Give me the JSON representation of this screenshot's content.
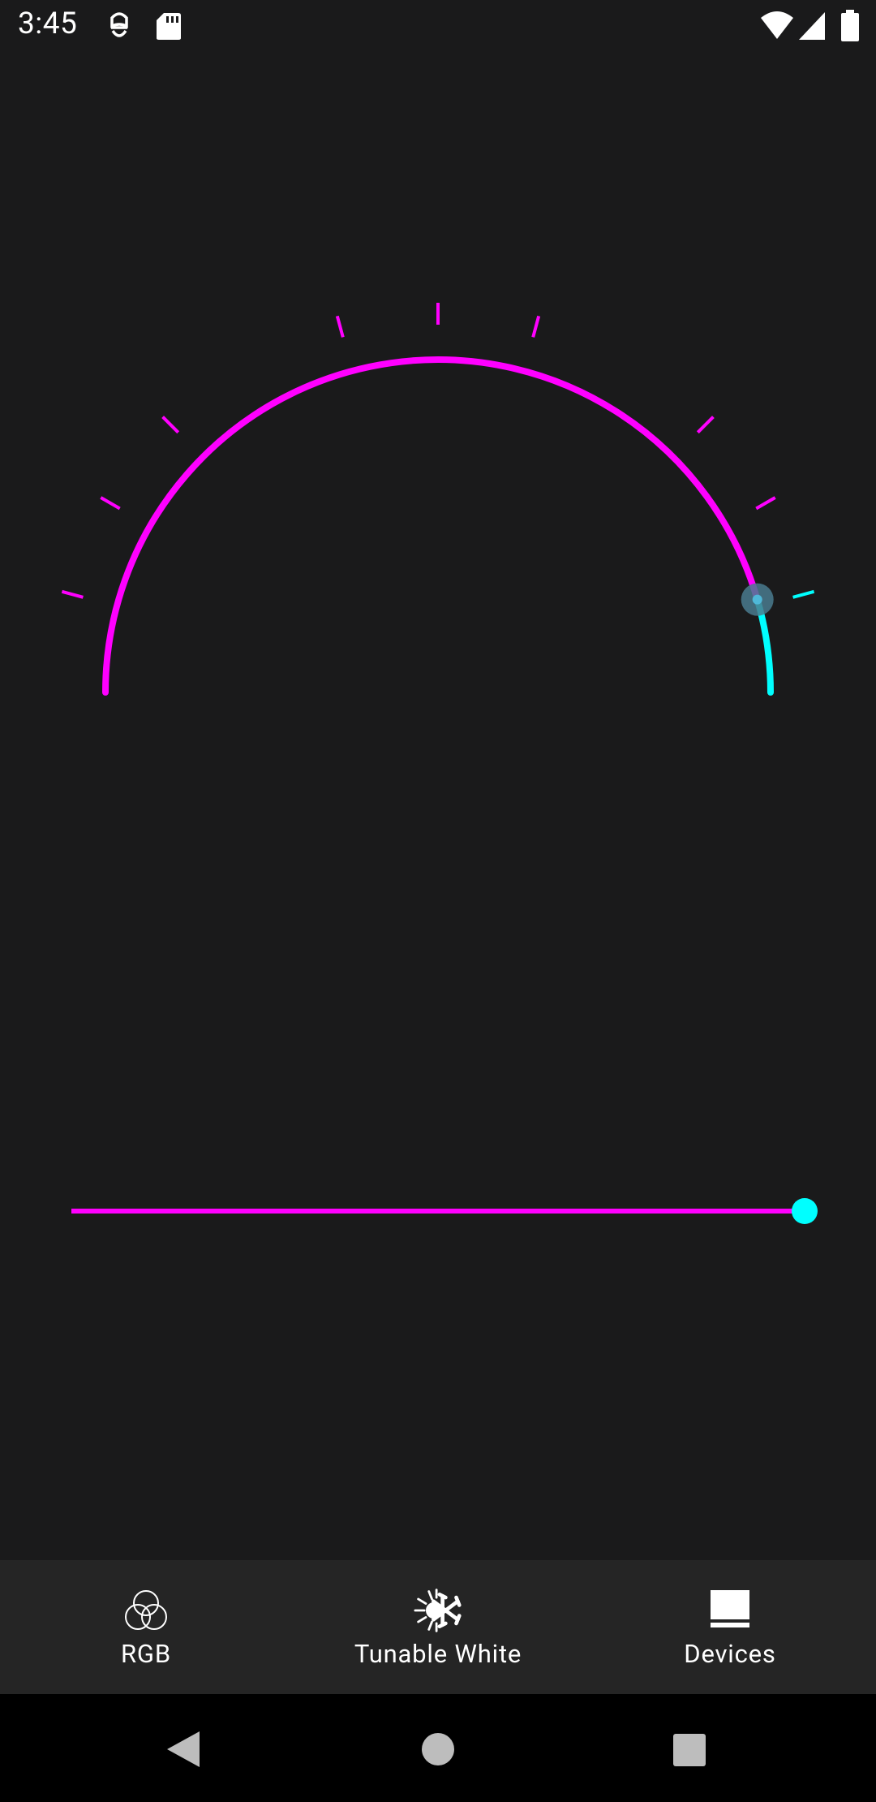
{
  "status_bar": {
    "time": "3:45",
    "icons": [
      "notification-app-icon",
      "sd-card-icon",
      "wifi-icon",
      "cell-signal-icon",
      "battery-icon"
    ]
  },
  "dial": {
    "value_fraction": 0.09,
    "track_color": "#ff00ff",
    "value_color": "#00ffff",
    "tick_count": 13
  },
  "slider": {
    "value_fraction": 1.0,
    "track_color": "#ff00ff",
    "thumb_color": "#00ffff"
  },
  "bottom_nav": {
    "items": [
      {
        "label": "RGB",
        "icon": "rgb-circles-icon"
      },
      {
        "label": "Tunable White",
        "icon": "sun-snowflake-icon"
      },
      {
        "label": "Devices",
        "icon": "devices-icon"
      }
    ],
    "selected_index": 1
  },
  "system_nav": [
    "back-icon",
    "home-icon",
    "recents-icon"
  ]
}
